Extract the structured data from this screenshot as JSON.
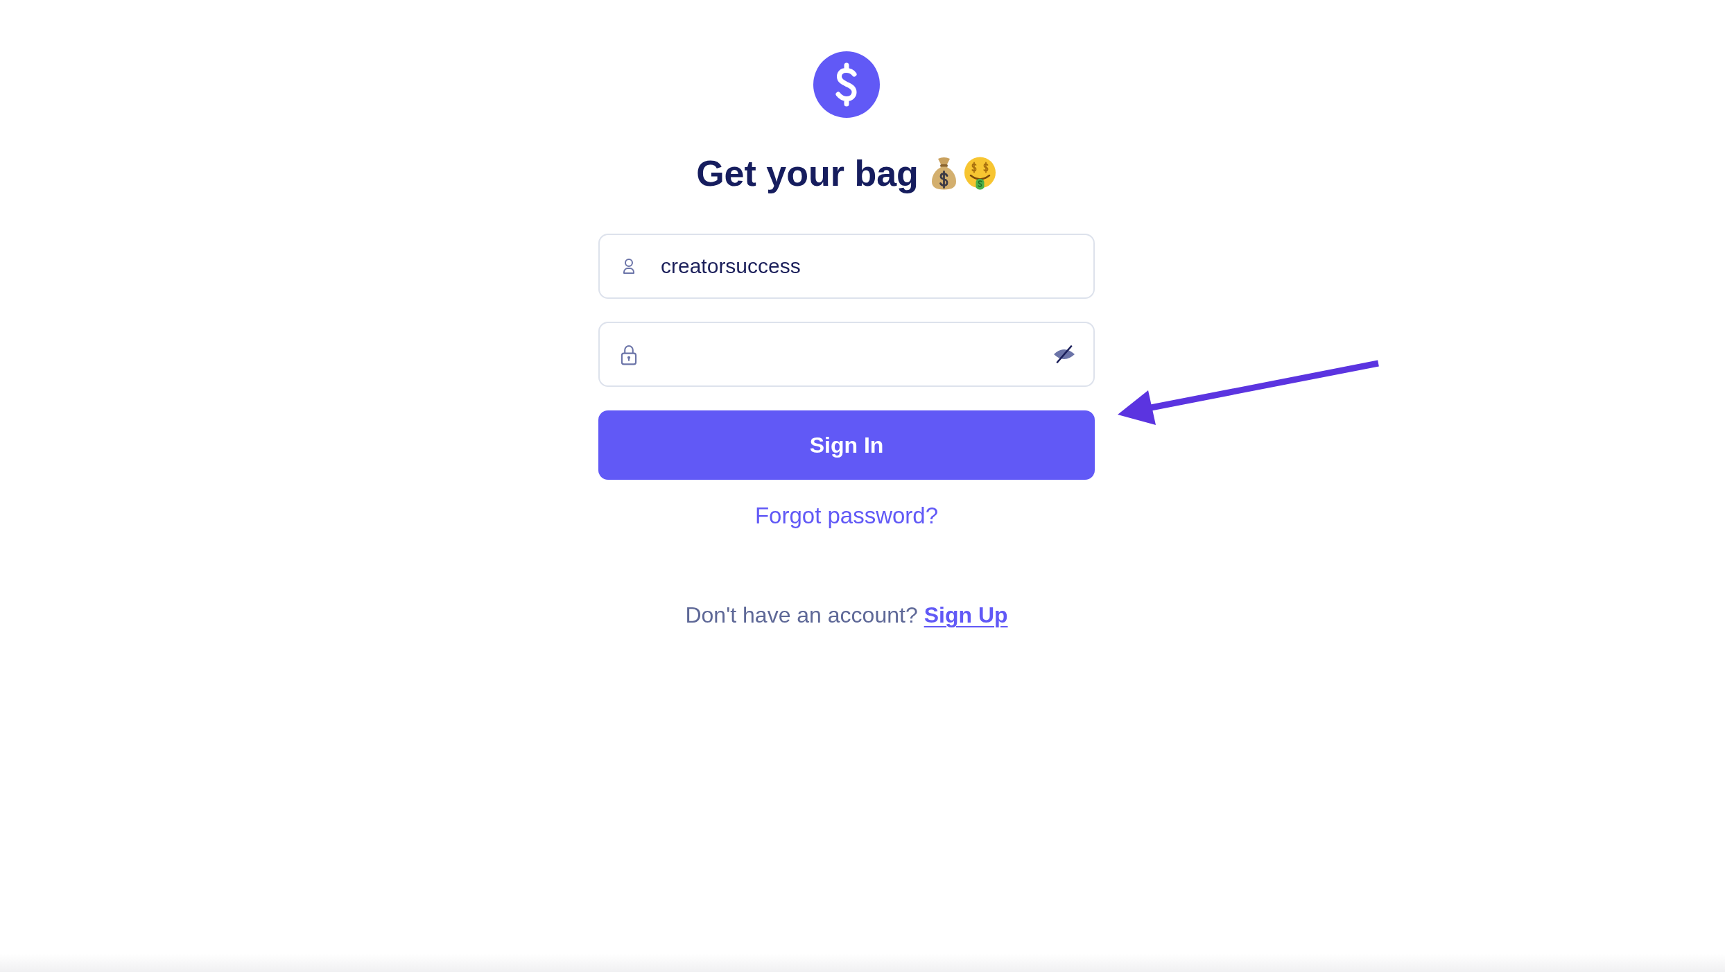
{
  "heading": "Get your bag",
  "username_field": {
    "value": "creatorsuccess"
  },
  "password_field": {
    "revealed": false
  },
  "sign_in_button": "Sign In",
  "forgot_password_link": "Forgot password?",
  "signup_prompt": {
    "text": "Don't have an account?",
    "link": "Sign Up"
  }
}
